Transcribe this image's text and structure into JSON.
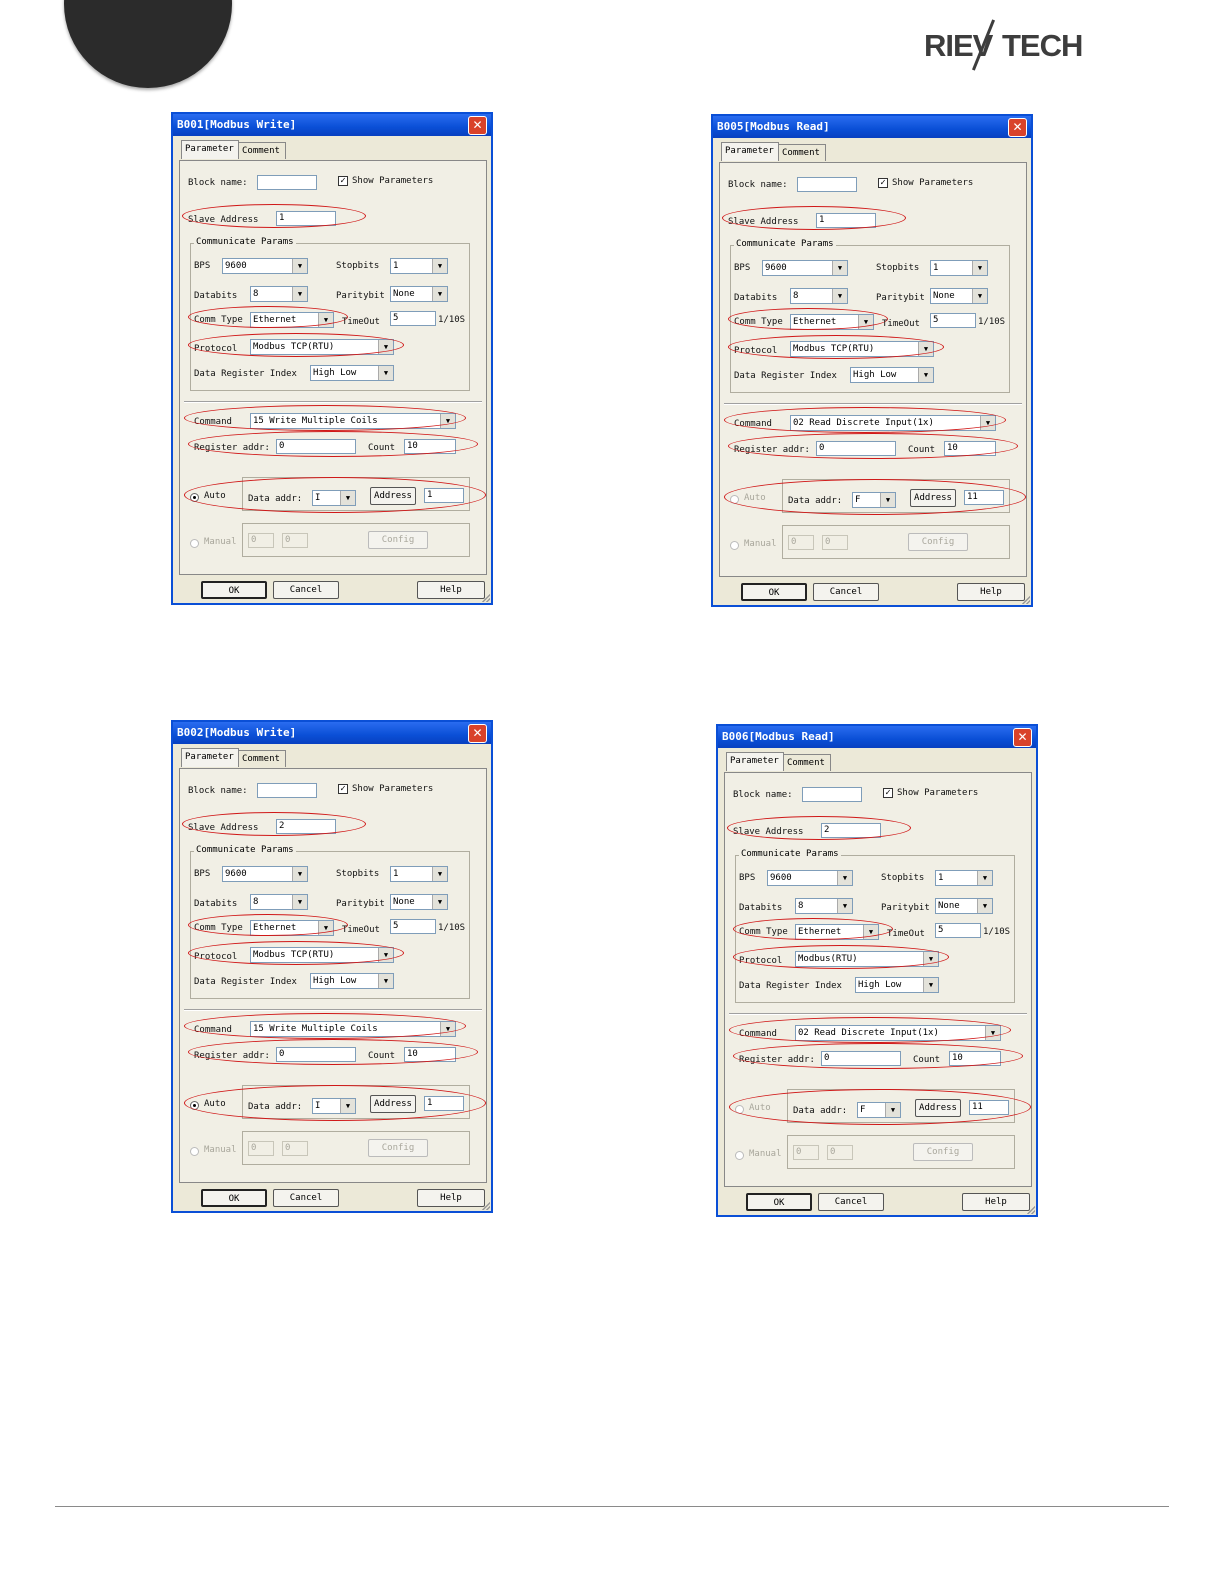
{
  "logo": {
    "part1": "RIEV",
    "part2": "TECH"
  },
  "common": {
    "tab_parameter": "Parameter",
    "tab_comment": "Comment",
    "block_name_label": "Block name:",
    "show_parameters_label": "Show Parameters",
    "slave_address_label": "Slave Address",
    "communicate_params_label": "Communicate Params",
    "bps_label": "BPS",
    "stopbits_label": "Stopbits",
    "databits_label": "Databits",
    "paritybit_label": "Paritybit",
    "comm_type_label": "Comm Type",
    "timeout_label": "TimeOut",
    "timeout_unit": "1/10S",
    "protocol_label": "Protocol",
    "data_register_index_label": "Data Register Index",
    "command_label": "Command",
    "register_addr_label": "Register addr:",
    "count_label": "Count",
    "auto_label": "Auto",
    "data_addr_label": "Data addr:",
    "address_button": "Address",
    "manual_label": "Manual",
    "config_button": "Config",
    "ok_button": "OK",
    "cancel_button": "Cancel",
    "help_button": "Help",
    "close_glyph": "✕",
    "check_glyph": "✓",
    "arrow_glyph": "▼"
  },
  "dialogs": [
    {
      "title": "B001[Modbus Write]",
      "block_name": "",
      "show_parameters": true,
      "slave_address": "1",
      "bps": "9600",
      "stopbits": "1",
      "databits": "8",
      "paritybit": "None",
      "comm_type": "Ethernet",
      "timeout": "5",
      "protocol": "Modbus TCP(RTU)",
      "data_register_index": "High Low",
      "command": "15 Write Multiple Coils",
      "register_addr": "0",
      "count": "10",
      "auto_selected": true,
      "data_addr": "I",
      "address": "1",
      "manual_v1": "0",
      "manual_v2": "0"
    },
    {
      "title": "B005[Modbus Read]",
      "block_name": "",
      "show_parameters": true,
      "slave_address": "1",
      "bps": "9600",
      "stopbits": "1",
      "databits": "8",
      "paritybit": "None",
      "comm_type": "Ethernet",
      "timeout": "5",
      "protocol": "Modbus TCP(RTU)",
      "data_register_index": "High Low",
      "command": "02 Read Discrete Input(1x)",
      "register_addr": "0",
      "count": "10",
      "auto_selected": false,
      "data_addr": "F",
      "address": "11",
      "manual_v1": "0",
      "manual_v2": "0"
    },
    {
      "title": "B002[Modbus Write]",
      "block_name": "",
      "show_parameters": true,
      "slave_address": "2",
      "bps": "9600",
      "stopbits": "1",
      "databits": "8",
      "paritybit": "None",
      "comm_type": "Ethernet",
      "timeout": "5",
      "protocol": "Modbus TCP(RTU)",
      "data_register_index": "High Low",
      "command": "15 Write Multiple Coils",
      "register_addr": "0",
      "count": "10",
      "auto_selected": true,
      "data_addr": "I",
      "address": "1",
      "manual_v1": "0",
      "manual_v2": "0"
    },
    {
      "title": "B006[Modbus Read]",
      "block_name": "",
      "show_parameters": true,
      "slave_address": "2",
      "bps": "9600",
      "stopbits": "1",
      "databits": "8",
      "paritybit": "None",
      "comm_type": "Ethernet",
      "timeout": "5",
      "protocol": "Modbus(RTU)",
      "data_register_index": "High Low",
      "command": "02 Read Discrete Input(1x)",
      "register_addr": "0",
      "count": "10",
      "auto_selected": false,
      "data_addr": "F",
      "address": "11",
      "manual_v1": "0",
      "manual_v2": "0"
    }
  ]
}
